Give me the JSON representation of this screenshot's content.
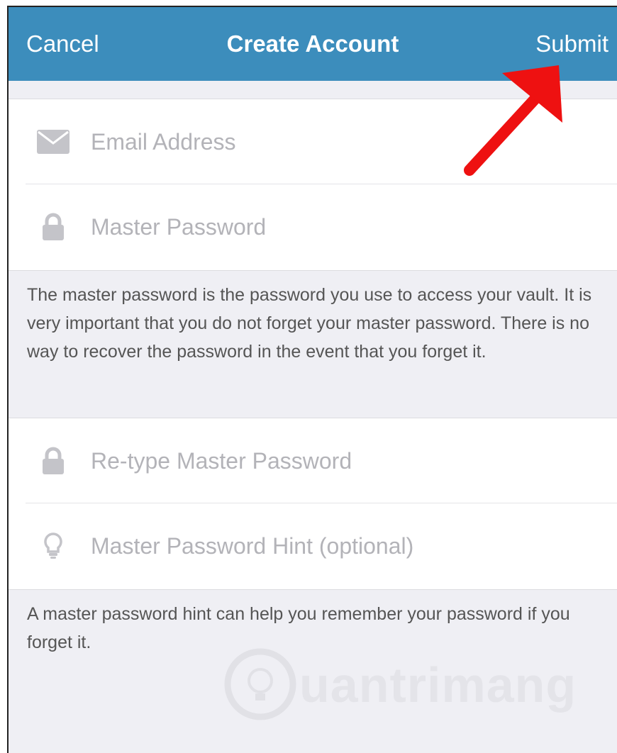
{
  "header": {
    "cancel_label": "Cancel",
    "title": "Create Account",
    "submit_label": "Submit",
    "background": "#3c8dbc"
  },
  "form": {
    "email": {
      "placeholder": "Email Address",
      "value": "",
      "icon": "envelope-icon"
    },
    "master_password": {
      "placeholder": "Master Password",
      "value": "",
      "icon": "lock-icon"
    },
    "master_password_note": "The master password is the password you use to access your vault. It is very important that you do not forget your master password. There is no way to recover the password in the event that you forget it.",
    "retype_password": {
      "placeholder": "Re-type Master Password",
      "value": "",
      "icon": "lock-icon"
    },
    "hint": {
      "placeholder": "Master Password Hint (optional)",
      "value": "",
      "icon": "lightbulb-icon"
    },
    "hint_note": "A master password hint can help you remember your password if you forget it."
  },
  "watermark": {
    "text": "uantrimang"
  },
  "annotation": {
    "arrow_color": "#ee1111"
  }
}
